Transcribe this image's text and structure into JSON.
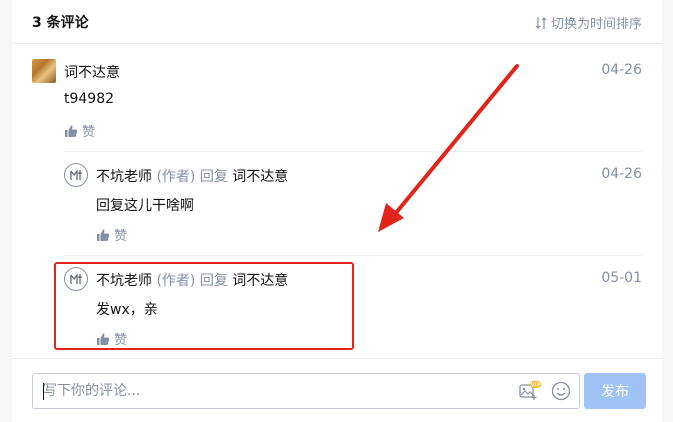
{
  "header": {
    "title": "3 条评论",
    "sort_label": "切换为时间排序"
  },
  "comments": [
    {
      "author": "词不达意",
      "content": "t94982",
      "date": "04-26",
      "like_label": "赞"
    },
    {
      "author": "不坑老师",
      "role": "(作者)",
      "reply_word": "回复",
      "reply_to": "词不达意",
      "content": "回复这儿干啥啊",
      "date": "04-26",
      "like_label": "赞"
    },
    {
      "author": "不坑老师",
      "role": "(作者)",
      "reply_word": "回复",
      "reply_to": "词不达意",
      "content": "发wx，亲",
      "date": "05-01",
      "like_label": "赞"
    }
  ],
  "footer": {
    "input_placeholder": "写下你的评论...",
    "input_value": "",
    "vip_badge": "VIP",
    "publish_label": "发布"
  },
  "colors": {
    "accent": "#0084ff",
    "publish_disabled": "#9fc3f5",
    "muted": "#8590a6",
    "annotation_red": "#e1251b"
  }
}
